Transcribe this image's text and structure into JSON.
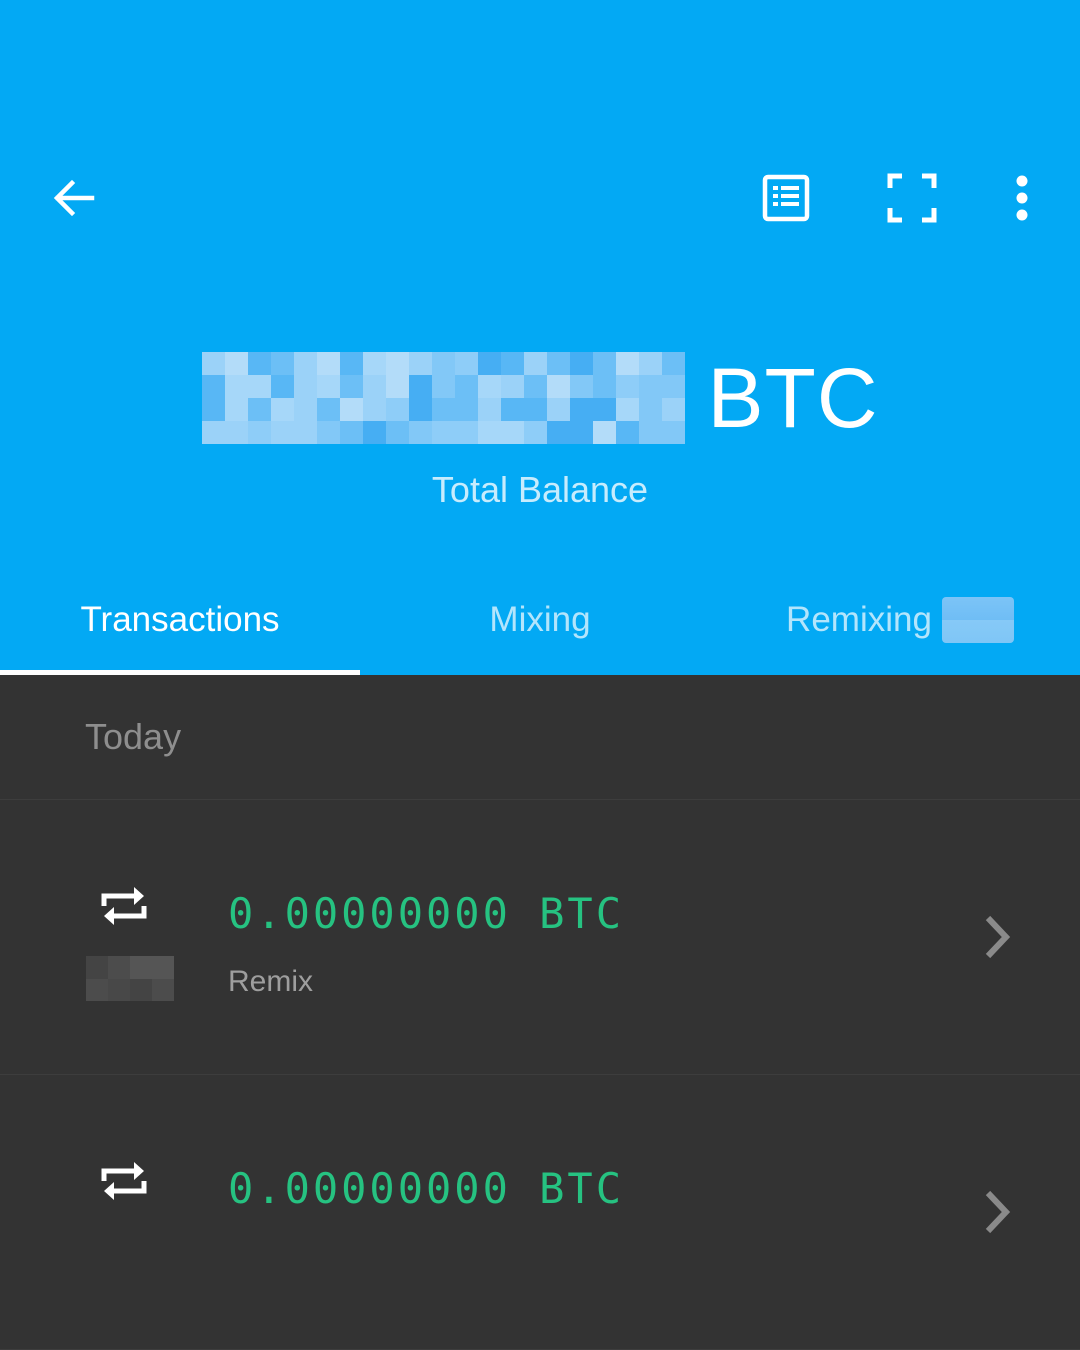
{
  "toolbar": {
    "back_icon": "arrow-left-icon",
    "list_icon": "receipt-list-icon",
    "scan_icon": "scan-frame-icon",
    "more_icon": "more-vert-icon"
  },
  "balance": {
    "unit": "BTC",
    "label": "Total Balance"
  },
  "tabs": [
    {
      "label": "Transactions",
      "active": true
    },
    {
      "label": "Mixing",
      "active": false
    },
    {
      "label": "Remixing",
      "active": false
    }
  ],
  "section": {
    "label": "Today"
  },
  "transactions": [
    {
      "amount": "0.00000000 BTC",
      "type": "Remix",
      "icon": "repeat-icon"
    },
    {
      "amount": "0.00000000 BTC",
      "type": "",
      "icon": "repeat-icon"
    }
  ],
  "colors": {
    "header": "#03a9f4",
    "background": "#333333",
    "amount": "#26c281"
  }
}
